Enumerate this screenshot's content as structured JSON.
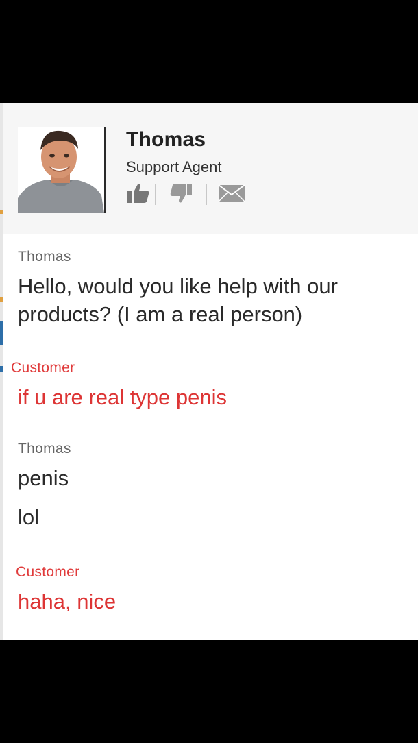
{
  "agent": {
    "name": "Thomas",
    "role": "Support Agent",
    "icons": [
      "thumbs-up-icon",
      "thumbs-down-icon",
      "envelope-icon"
    ]
  },
  "messages": [
    {
      "sender": "Thomas",
      "role": "agent",
      "lines": [
        "Hello, would you like help with our products? (I am a real person)"
      ]
    },
    {
      "sender": "Customer",
      "role": "customer",
      "lines": [
        "if u are real type penis"
      ]
    },
    {
      "sender": "Thomas",
      "role": "agent",
      "lines": [
        "penis",
        "lol"
      ]
    },
    {
      "sender": "Customer",
      "role": "customer",
      "lines": [
        "haha, nice"
      ]
    }
  ],
  "colors": {
    "customer": "#dd3535",
    "agent_text": "#2a2a2a",
    "header_bg": "#f6f6f6"
  }
}
